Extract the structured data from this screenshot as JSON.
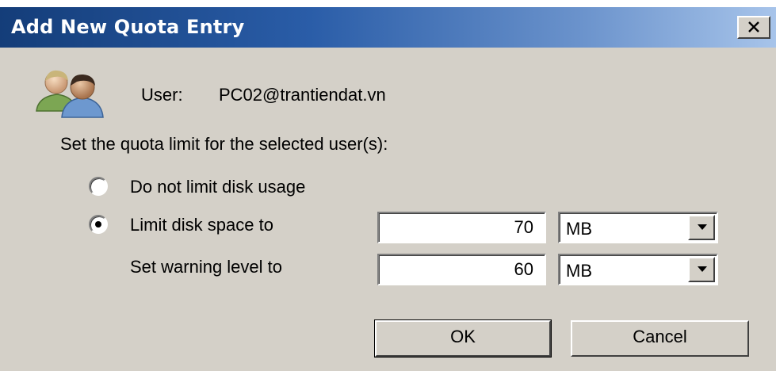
{
  "window": {
    "title": "Add New Quota Entry",
    "close_glyph": "✕"
  },
  "user": {
    "label": "User:",
    "value": "PC02@trantiendat.vn",
    "icon": "users-icon"
  },
  "instruction": "Set the quota limit for the selected user(s):",
  "options": {
    "no_limit_label": "Do not limit disk usage",
    "limit_label": "Limit disk space to",
    "selected": "limit"
  },
  "limit": {
    "value": "70",
    "unit": "MB"
  },
  "warning": {
    "label": "Set warning level to",
    "value": "60",
    "unit": "MB"
  },
  "buttons": {
    "ok": "OK",
    "cancel": "Cancel"
  },
  "colors": {
    "title_start": "#143d79",
    "title_end": "#a7c4ea",
    "face": "#d4d0c8"
  }
}
